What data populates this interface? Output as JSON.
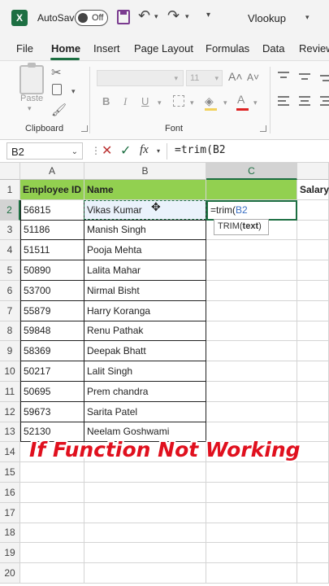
{
  "window": {
    "autosave_label": "AutoSave",
    "autosave_state": "Off",
    "document_title": "Vlookup"
  },
  "ribbon": {
    "tabs": [
      "File",
      "Home",
      "Insert",
      "Page Layout",
      "Formulas",
      "Data",
      "Review"
    ],
    "active_tab": "Home",
    "clipboard": {
      "paste_label": "Paste",
      "group_label": "Clipboard"
    },
    "font": {
      "size_value": "11",
      "group_label": "Font",
      "bold": "B",
      "italic": "I",
      "underline": "U"
    }
  },
  "formula_bar": {
    "name_box": "B2",
    "formula": "=trim(B2",
    "fx": "fx"
  },
  "columns": [
    "A",
    "B",
    "C"
  ],
  "rows": [
    "1",
    "2",
    "3",
    "4",
    "5",
    "6",
    "7",
    "8",
    "9",
    "10",
    "11",
    "12",
    "13",
    "14",
    "15",
    "16",
    "17",
    "18",
    "19",
    "20"
  ],
  "sheet": {
    "headers": {
      "a": "Employee ID",
      "b": "Name",
      "c": "",
      "d": "Salary"
    },
    "data": [
      {
        "id": "56815",
        "name": "Vikas Kumar"
      },
      {
        "id": "51186",
        "name": "Manish Singh"
      },
      {
        "id": "51511",
        "name": "Pooja Mehta"
      },
      {
        "id": "50890",
        "name": "Lalita Mahar"
      },
      {
        "id": "53700",
        "name": "Nirmal Bisht"
      },
      {
        "id": "55879",
        "name": "Harry Koranga"
      },
      {
        "id": "59848",
        "name": "Renu Pathak"
      },
      {
        "id": "58369",
        "name": "Deepak Bhatt"
      },
      {
        "id": "50217",
        "name": "Lalit Singh"
      },
      {
        "id": "50695",
        "name": "Prem chandra"
      },
      {
        "id": "59673",
        "name": "Sarita Patel"
      },
      {
        "id": "52130",
        "name": "Neelam Goshwami"
      }
    ],
    "editing_cell": {
      "prefix": "=trim(",
      "ref": "B2"
    },
    "tooltip": {
      "fn": "TRIM(",
      "arg": "text",
      "close": ")"
    }
  },
  "overlay": {
    "caption": "If Function Not Working"
  },
  "colors": {
    "accent": "#1d6f42",
    "header_fill": "#92d050",
    "caption": "#e0101e"
  }
}
